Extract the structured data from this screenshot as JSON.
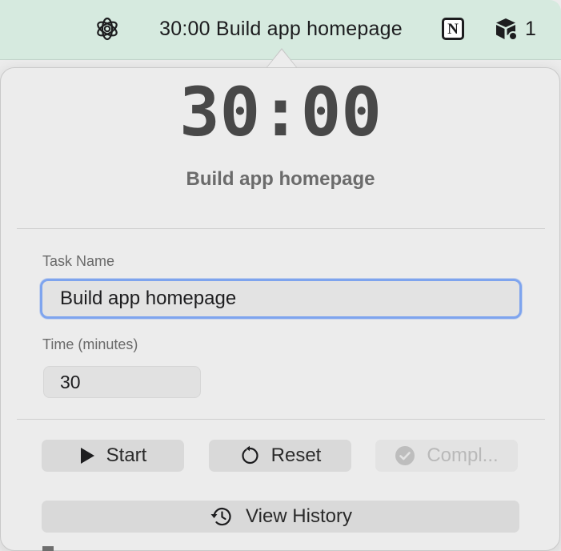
{
  "menubar": {
    "chatgpt_icon": "chatgpt-icon",
    "timer_label": "30:00 Build app homepage",
    "notion_letter": "N",
    "box_count": "1"
  },
  "timer": {
    "time": "30:00",
    "task_title": "Build app homepage"
  },
  "form": {
    "task_name_label": "Task Name",
    "task_name_value": "Build app homepage",
    "time_label": "Time (minutes)",
    "time_value": "30"
  },
  "buttons": {
    "start_label": "Start",
    "reset_label": "Reset",
    "complete_label": "Compl...",
    "history_label": "View History"
  },
  "colors": {
    "menubar_bg": "#d6eadf",
    "popover_bg": "#ececec",
    "focus_ring": "#7ea4ee",
    "big_time": "#484848"
  }
}
